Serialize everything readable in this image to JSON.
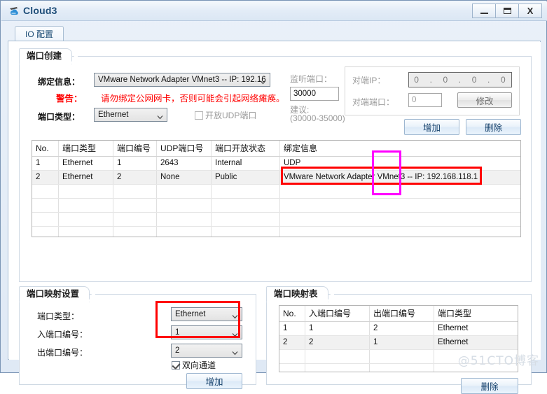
{
  "window": {
    "title": "Cloud3",
    "icon": "cloud-icon",
    "buttons": {
      "minimize": "minimize-icon",
      "maximize": "maximize-icon",
      "close": "X"
    }
  },
  "tabs": [
    {
      "label": "IO 配置",
      "active": true
    }
  ],
  "port_create": {
    "title": "端口创建",
    "bind_label": "绑定信息：",
    "bind_value": "VMware Network Adapter VMnet3 -- IP: 192.16",
    "warning_label": "警告：",
    "warning_text": "请勿绑定公网网卡，否则可能会引起网络瘫痪。",
    "port_type_label": "端口类型：",
    "port_type_value": "Ethernet",
    "udp_checkbox_label": "开放UDP端口",
    "udp_checked": false,
    "listen_port_label": "监听端口：",
    "listen_port_value": "30000",
    "suggest_label": "建议:",
    "suggest_range": "(30000-35000)",
    "peer_ip_label": "对端IP：",
    "peer_ip_octets": [
      "0",
      "0",
      "0",
      "0"
    ],
    "peer_port_label": "对端端口：",
    "peer_port_value": "0",
    "modify_button": "修改",
    "add_button": "增加",
    "delete_button": "删除"
  },
  "port_table": {
    "columns": [
      "No.",
      "端口类型",
      "端口编号",
      "UDP端口号",
      "端口开放状态",
      "绑定信息"
    ],
    "rows": [
      [
        "1",
        "Ethernet",
        "1",
        "2643",
        "Internal",
        "UDP"
      ],
      [
        "2",
        "Ethernet",
        "2",
        "None",
        "Public",
        "VMware Network Adapter VMnet3 -- IP: 192.168.118.1"
      ]
    ],
    "empty_rows": 5,
    "selected_row_index": 1
  },
  "mapping_settings": {
    "title": "端口映射设置",
    "port_type_label": "端口类型：",
    "port_type_value": "Ethernet",
    "in_port_label": "入端口编号：",
    "in_port_value": "1",
    "out_port_label": "出端口编号：",
    "out_port_value": "2",
    "bidirectional_label": "双向通道",
    "bidirectional_checked": true,
    "add_button": "增加"
  },
  "mapping_table": {
    "title": "端口映射表",
    "columns": [
      "No.",
      "入端口编号",
      "出端口编号",
      "端口类型"
    ],
    "rows": [
      [
        "1",
        "1",
        "2",
        "Ethernet"
      ],
      [
        "2",
        "2",
        "1",
        "Ethernet"
      ]
    ],
    "empty_rows": 3,
    "selected_row_index": 1,
    "delete_button": "删除"
  },
  "annotations": {
    "red_boxes": 2,
    "magenta_boxes": 1,
    "red_color": "#ff0000",
    "magenta_color": "#ff00ff"
  },
  "watermark": "@51CTO博客"
}
